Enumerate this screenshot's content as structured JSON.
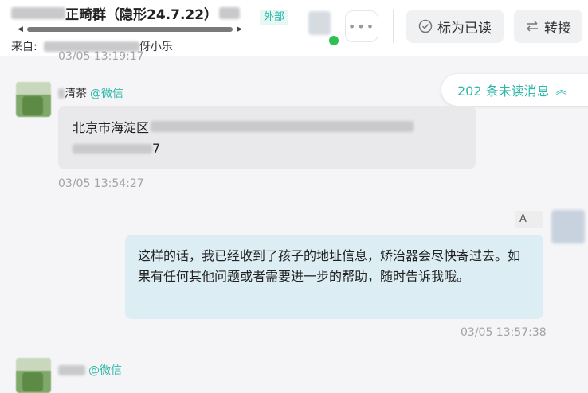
{
  "header": {
    "title": "正畸群（隐形24.7.22）",
    "external_tag": "外部",
    "from_label": "来自:",
    "from_suffix": "伢小乐",
    "more_label": "•••",
    "mark_read_label": "标为已读",
    "transfer_label": "转接",
    "mark_read_icon": "check-circle-icon",
    "transfer_icon": "swap-arrows-icon"
  },
  "unread_banner": {
    "label": "202 条未读消息",
    "icon": "double-chevron-up-icon"
  },
  "messages": [
    {
      "timestamp": "03/05 13:19:17"
    },
    {
      "sender_suffix": "清茶",
      "source": "@微信",
      "line1_prefix": "北京市海淀区",
      "line2_suffix": "7",
      "timestamp": "03/05 13:54:27"
    },
    {
      "tag_prefix": "A",
      "text": "这样的话，我已经收到了孩子的地址信息，矫治器会尽快寄过去。如果有任何其他问题或者需要进一步的帮助，随时告诉我哦。",
      "timestamp": "03/05 13:57:38"
    },
    {
      "source": "@微信"
    }
  ],
  "colors": {
    "accent": "#2fb8a8",
    "online": "#2fbf53",
    "outgoing_bubble": "#dcedf3",
    "incoming_bubble": "#e9e9eb"
  }
}
